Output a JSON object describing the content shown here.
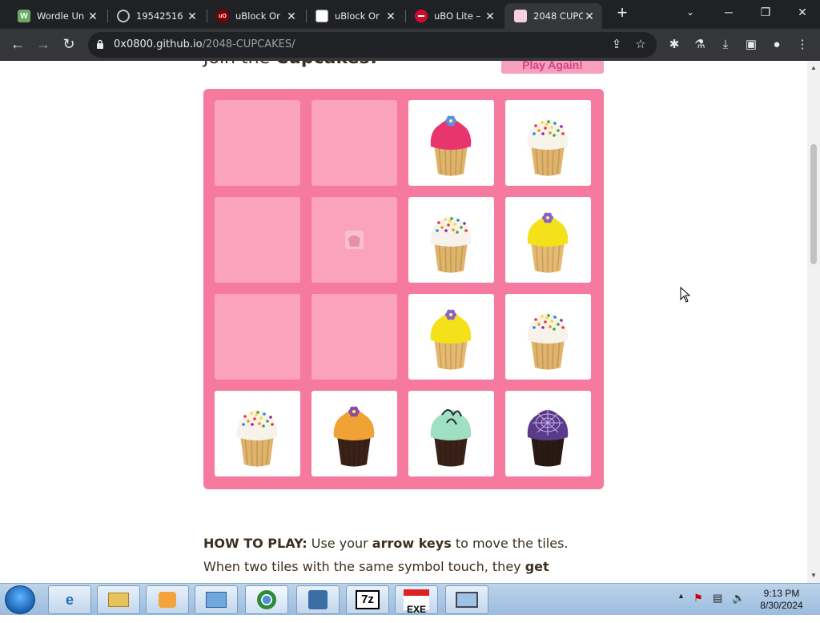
{
  "browser": {
    "tabs": [
      {
        "title": "Wordle Un",
        "icon": "wordle-icon",
        "fav_color": "#6aaa64",
        "fav_letter": "W"
      },
      {
        "title": "19542516",
        "icon": "globe-icon",
        "fav_color": "#5f6368",
        "fav_letter": ""
      },
      {
        "title": "uBlock Or",
        "icon": "ublock-icon",
        "fav_color": "#800000",
        "fav_letter": "uO"
      },
      {
        "title": "uBlock Or",
        "icon": "github-icon",
        "fav_color": "#ffffff",
        "fav_letter": ""
      },
      {
        "title": "uBO Lite –",
        "icon": "ubo-lite-icon",
        "fav_color": "#c8102e",
        "fav_letter": ""
      },
      {
        "title": "2048 CUPC",
        "icon": "cupcake-favicon",
        "fav_color": "#f6d0dc",
        "fav_letter": ""
      }
    ],
    "active_tab": 5,
    "url_host": "0x0800.github.io",
    "url_path": "/2048-CUPCAKES/"
  },
  "page": {
    "heading_prefix": "Join the ",
    "heading_bold": "Cupcakes!",
    "play_again": "Play Again!",
    "board": {
      "size": 4,
      "tiles": [
        {
          "row": 0,
          "col": 2,
          "kind": "pink-sprinkle"
        },
        {
          "row": 0,
          "col": 3,
          "kind": "white-sprinkles"
        },
        {
          "row": 1,
          "col": 1,
          "kind": "ghost"
        },
        {
          "row": 1,
          "col": 2,
          "kind": "white-sprinkles"
        },
        {
          "row": 1,
          "col": 3,
          "kind": "yellow-flower"
        },
        {
          "row": 2,
          "col": 2,
          "kind": "yellow-flower"
        },
        {
          "row": 2,
          "col": 3,
          "kind": "white-sprinkles"
        },
        {
          "row": 3,
          "col": 0,
          "kind": "white-sprinkles"
        },
        {
          "row": 3,
          "col": 1,
          "kind": "orange-chocolate"
        },
        {
          "row": 3,
          "col": 2,
          "kind": "mint-chocolate"
        },
        {
          "row": 3,
          "col": 3,
          "kind": "purple-spiderweb"
        }
      ]
    },
    "howto_label": "HOW TO PLAY:",
    "howto_t1": " Use your ",
    "howto_b1": "arrow keys",
    "howto_t2": " to move the tiles. When two tiles with the same symbol touch, they ",
    "howto_b2": "get promoted!"
  },
  "colors": {
    "board_bg": "#f67a9f",
    "cell_bg": "#fba2bd",
    "accent": "#d64080"
  },
  "taskbar": {
    "apps": [
      "ie-icon",
      "explorer-icon",
      "media-player-icon",
      "control-panel-icon",
      "chrome-icon",
      "app-icon",
      "7zip-icon",
      "youtube-exe-icon",
      "remote-desktop-icon"
    ],
    "tray_icons": [
      "show-hidden-icon",
      "network-error-icon",
      "action-center-icon",
      "volume-muted-icon"
    ],
    "time": "9:13 PM",
    "date": "8/30/2024",
    "app_text_7z": "7z",
    "app_text_yt": "EXE"
  }
}
